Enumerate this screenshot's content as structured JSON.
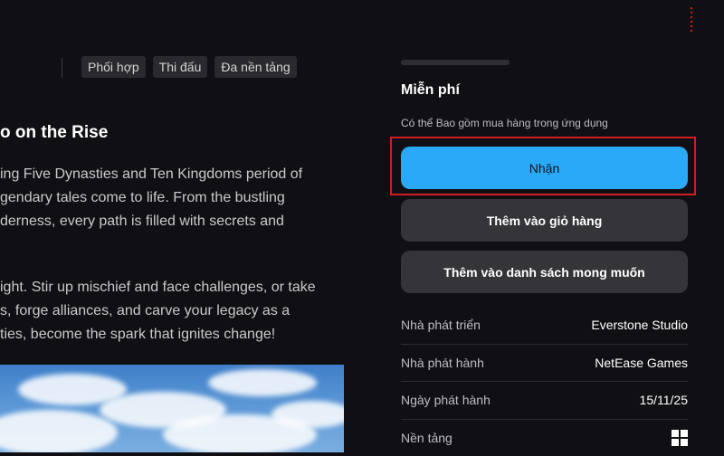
{
  "tags": [
    "Phối hợp",
    "Thi đấu",
    "Đa nền tảng"
  ],
  "description": {
    "heading": "o on the Rise",
    "paragraph1": [
      "ing Five Dynasties and Ten Kingdoms period of",
      "gendary tales come to life. From the bustling",
      "derness, every path is filled with secrets and"
    ],
    "paragraph2": [
      "ight. Stir up mischief and face challenges, or take",
      "s, forge alliances, and carve your legacy as a",
      "ties, become the spark that ignites change!"
    ]
  },
  "purchase": {
    "price": "Miễn phí",
    "note": "Có thể Bao gồm mua hàng trong ứng dụng",
    "get_label": "Nhận",
    "cart_label": "Thêm vào giỏ hàng",
    "wishlist_label": "Thêm vào danh sách mong muốn"
  },
  "info": {
    "developer_label": "Nhà phát triển",
    "developer_value": "Everstone Studio",
    "publisher_label": "Nhà phát hành",
    "publisher_value": "NetEase Games",
    "release_label": "Ngày phát hành",
    "release_value": "15/11/25",
    "platform_label": "Nền tảng",
    "platform_icon": "windows-icon"
  },
  "colors": {
    "accent": "#2aa9f8",
    "highlight": "#d11d1d",
    "background": "#101014"
  }
}
